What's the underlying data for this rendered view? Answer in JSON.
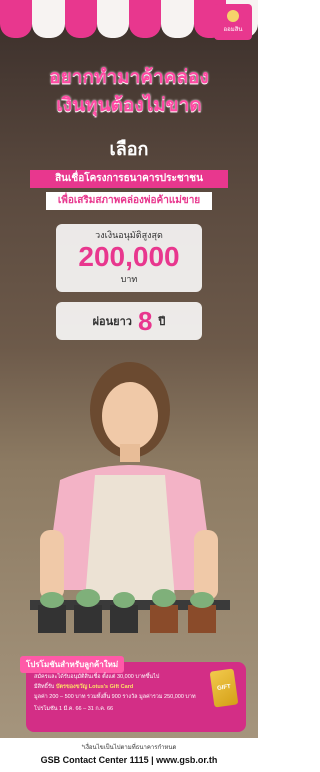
{
  "brand": {
    "logo_text": "ออมสิน"
  },
  "headline": {
    "line1": "อยากทำมาค้าคล่อง",
    "line2": "เงินทุนต้องไม่ขาด",
    "line3": "เลือก"
  },
  "tags": {
    "primary": "สินเชื่อโครงการธนาคารประชาชน",
    "secondary": "เพื่อเสริมสภาพคล่องพ่อค้าแม่ขาย"
  },
  "amount": {
    "label": "วงเงินอนุมัติสูงสุด",
    "value": "200,000",
    "unit": "บาท"
  },
  "term": {
    "prefix": "ผ่อนยาว",
    "value": "8",
    "suffix": "ปี"
  },
  "promo": {
    "title": "โปรโมชันสำหรับลูกค้าใหม่",
    "line1": "สมัครและได้รับอนุมัติสินเชื่อ ตั้งแต่ 30,000 บาทขึ้นไป",
    "line2_a": "มีสิทธิ์รับ ",
    "line2_b": "บัตรของขวัญ Lotus's Gift Card",
    "line3": "มูลค่า 200 – 500 บาท รวมทั้งสิ้น 900 รางวัล มูลค่ารวม 250,000 บาท",
    "line4": "โปรโมชัน 1 มี.ค. 66 – 31 ก.ค. 66",
    "card_text": "GIFT"
  },
  "footer": {
    "note": "*เงื่อนไขเป็นไปตามที่ธนาคารกำหนด",
    "contact": "GSB Contact Center 1115 | www.gsb.or.th"
  },
  "colors": {
    "brand_pink": "#e8378e",
    "accent_yellow": "#f2c94c"
  }
}
